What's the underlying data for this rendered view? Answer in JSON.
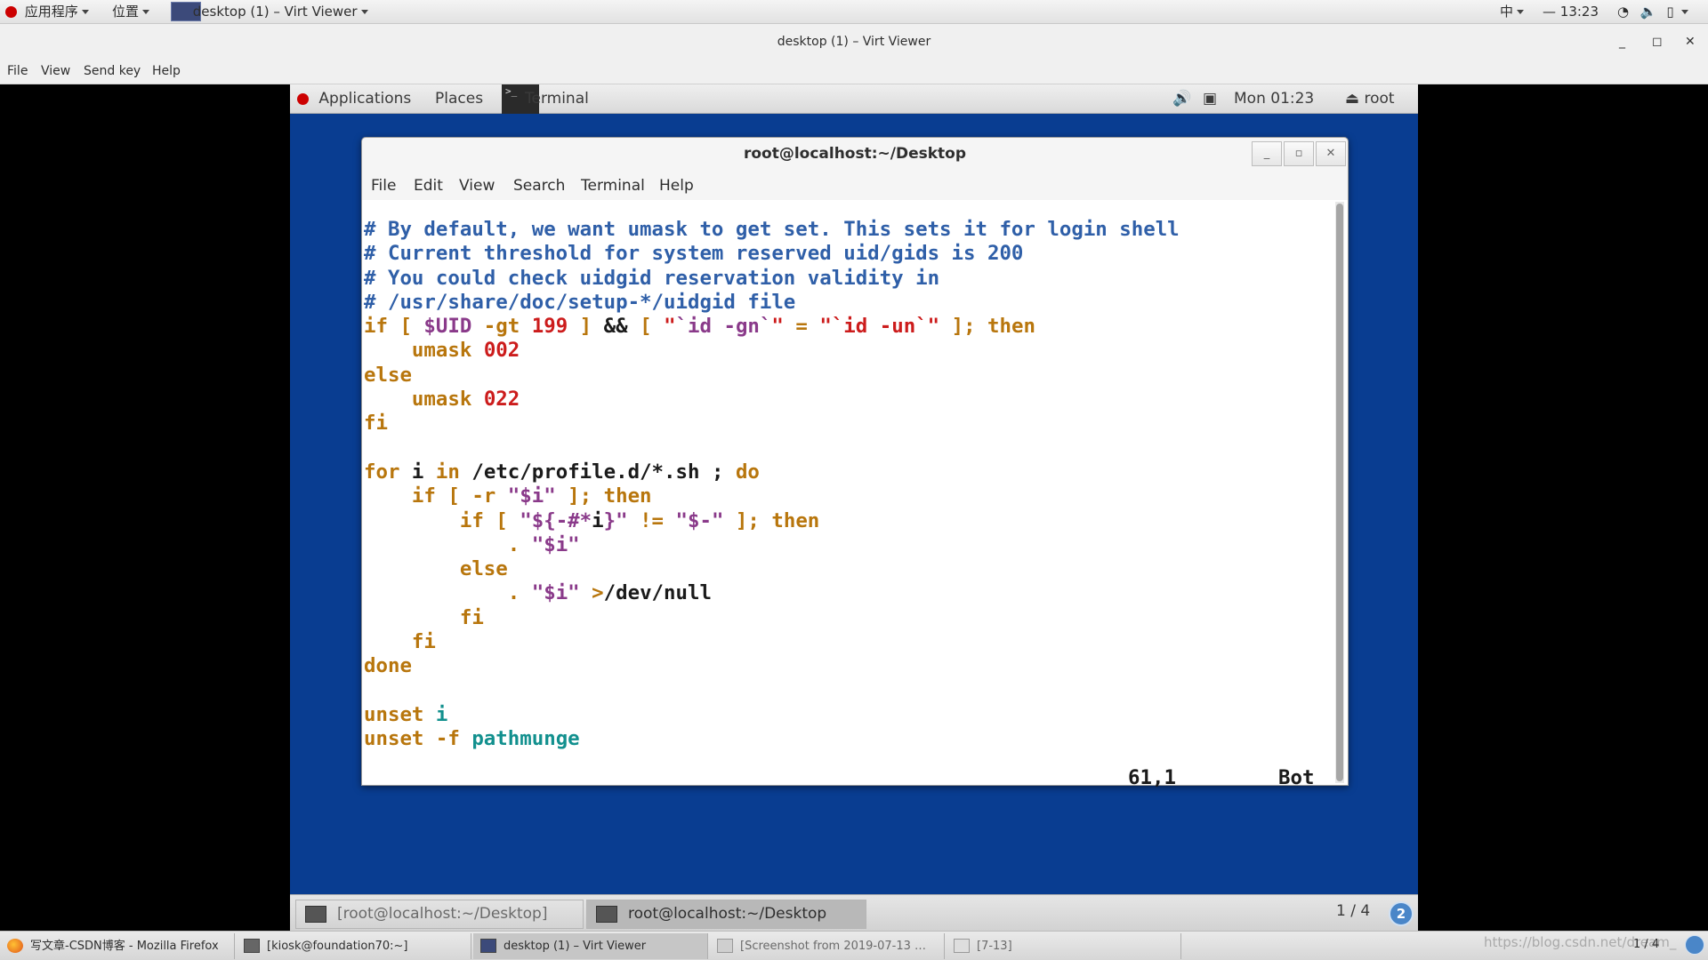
{
  "host_panel": {
    "applications": "应用程序",
    "places": "位置",
    "active_window": "desktop (1) – Virt Viewer",
    "input_method": "中",
    "clock": "13:23"
  },
  "viewer": {
    "title": "desktop (1) – Virt Viewer",
    "menu": [
      "File",
      "View",
      "Send key",
      "Help"
    ]
  },
  "guest_panel": {
    "applications": "Applications",
    "places": "Places",
    "terminal": "Terminal",
    "clock": "Mon 01:23",
    "user": "root"
  },
  "terminal": {
    "title": "root@localhost:~/Desktop",
    "menu": [
      "File",
      "Edit",
      "View",
      "Search",
      "Terminal",
      "Help"
    ],
    "lines": [
      [
        {
          "t": "# By default, we want umask to get set. This sets it for login shell",
          "c": "cm"
        }
      ],
      [
        {
          "t": "# Current threshold for system reserved uid/gids is 200",
          "c": "cm"
        }
      ],
      [
        {
          "t": "# You could check uidgid reservation validity in",
          "c": "cm"
        }
      ],
      [
        {
          "t": "# /usr/share/doc/setup-*/uidgid file",
          "c": "cm"
        }
      ],
      [
        {
          "t": "if [ ",
          "c": "kw"
        },
        {
          "t": "$UID",
          "c": "vr"
        },
        {
          "t": " -gt ",
          "c": "kw"
        },
        {
          "t": "199",
          "c": "nm"
        },
        {
          "t": " ] ",
          "c": "kw"
        },
        {
          "t": "&&",
          "c": "tx"
        },
        {
          "t": " [ ",
          "c": "kw"
        },
        {
          "t": "\"",
          "c": "nm"
        },
        {
          "t": "`id -gn`",
          "c": "vr"
        },
        {
          "t": "\"",
          "c": "nm"
        },
        {
          "t": " = ",
          "c": "kw"
        },
        {
          "t": "\"",
          "c": "nm"
        },
        {
          "t": "`id -un`",
          "c": "nm"
        },
        {
          "t": "\"",
          "c": "nm"
        },
        {
          "t": " ]; then",
          "c": "kw"
        }
      ],
      [
        {
          "t": "    umask ",
          "c": "kw"
        },
        {
          "t": "002",
          "c": "nm"
        }
      ],
      [
        {
          "t": "else",
          "c": "kw"
        }
      ],
      [
        {
          "t": "    umask ",
          "c": "kw"
        },
        {
          "t": "022",
          "c": "nm"
        }
      ],
      [
        {
          "t": "fi",
          "c": "kw"
        }
      ],
      [
        {
          "t": "",
          "c": "tx"
        }
      ],
      [
        {
          "t": "for",
          "c": "kw"
        },
        {
          "t": " i ",
          "c": "tx"
        },
        {
          "t": "in",
          "c": "kw"
        },
        {
          "t": " /etc/profile.d/*.sh ; ",
          "c": "tx"
        },
        {
          "t": "do",
          "c": "kw"
        }
      ],
      [
        {
          "t": "    if [ -r ",
          "c": "kw"
        },
        {
          "t": "\"$i\"",
          "c": "vr"
        },
        {
          "t": " ]; then",
          "c": "kw"
        }
      ],
      [
        {
          "t": "        if [ ",
          "c": "kw"
        },
        {
          "t": "\"${-#*",
          "c": "vr"
        },
        {
          "t": "i",
          "c": "tx"
        },
        {
          "t": "}\"",
          "c": "vr"
        },
        {
          "t": " != ",
          "c": "kw"
        },
        {
          "t": "\"$-\"",
          "c": "vr"
        },
        {
          "t": " ]; then",
          "c": "kw"
        }
      ],
      [
        {
          "t": "            . ",
          "c": "kw"
        },
        {
          "t": "\"$i\"",
          "c": "vr"
        }
      ],
      [
        {
          "t": "        else",
          "c": "kw"
        }
      ],
      [
        {
          "t": "            . ",
          "c": "kw"
        },
        {
          "t": "\"$i\"",
          "c": "vr"
        },
        {
          "t": " >",
          "c": "kw"
        },
        {
          "t": "/dev/null",
          "c": "tx"
        }
      ],
      [
        {
          "t": "        fi",
          "c": "kw"
        }
      ],
      [
        {
          "t": "    fi",
          "c": "kw"
        }
      ],
      [
        {
          "t": "done",
          "c": "kw"
        }
      ],
      [
        {
          "t": "",
          "c": "tx"
        }
      ],
      [
        {
          "t": "unset ",
          "c": "kw"
        },
        {
          "t": "i",
          "c": "cy"
        }
      ],
      [
        {
          "t": "unset -f ",
          "c": "kw"
        },
        {
          "t": "pathmunge",
          "c": "cy"
        }
      ]
    ],
    "cursor_position": "61,1",
    "scroll_position": "Bot"
  },
  "guest_taskbar": {
    "tasks": [
      "[root@localhost:~/Desktop]",
      "root@localhost:~/Desktop"
    ],
    "page": "1 / 4",
    "workspace": "2"
  },
  "host_taskbar": {
    "tasks": [
      "写文章-CSDN博客 - Mozilla Firefox",
      "[kiosk@foundation70:~]",
      "desktop (1) – Virt Viewer",
      "[Screenshot from 2019-07-13 …",
      "[7-13]"
    ],
    "page": "1 / 4",
    "watermark": "https://blog.csdn.net/dream_"
  },
  "colors": {
    "guest_background": "#093d91",
    "comment": "#2f5fa8",
    "keyword": "#b8760d",
    "number": "#cc1c1c",
    "variable": "#8a3a8a",
    "builtin": "#12908e"
  }
}
